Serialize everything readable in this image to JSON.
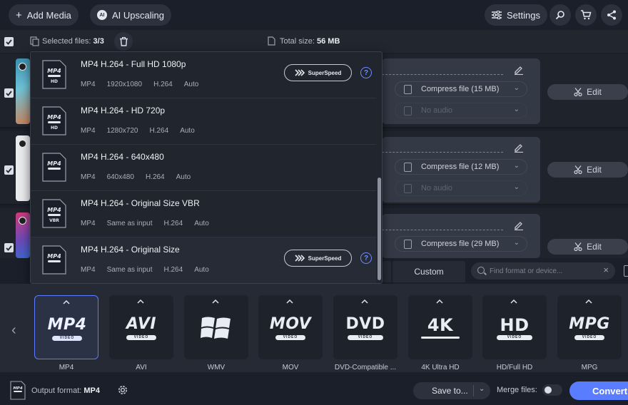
{
  "toolbar": {
    "add_media": "Add Media",
    "ai_upscaling": "AI Upscaling",
    "ai_badge": "AI",
    "settings": "Settings"
  },
  "selection": {
    "selected_label": "Selected files:",
    "selected_value": "3/3",
    "total_label": "Total size:",
    "total_value": "56 MB"
  },
  "files": [
    {
      "compress": "Compress file (15 MB)",
      "audio": "No audio",
      "edit": "Edit"
    },
    {
      "compress": "Compress file (12 MB)",
      "audio": "No audio",
      "edit": "Edit"
    },
    {
      "compress": "Compress file (29 MB)",
      "edit": "Edit"
    }
  ],
  "preset_menu": {
    "items": [
      {
        "name": "MP4 H.264 - Full HD 1080p",
        "icon_top": "MP4",
        "icon_bottom": "HD",
        "meta": [
          "MP4",
          "1920x1080",
          "H.264",
          "Auto"
        ],
        "superspeed": "SuperSpeed",
        "help": "?"
      },
      {
        "name": "MP4 H.264 - HD 720p",
        "icon_top": "MP4",
        "icon_bottom": "HD",
        "meta": [
          "MP4",
          "1280x720",
          "H.264",
          "Auto"
        ]
      },
      {
        "name": "MP4 H.264 - 640x480",
        "icon_top": "MP4",
        "icon_bottom": "",
        "meta": [
          "MP4",
          "640x480",
          "H.264",
          "Auto"
        ]
      },
      {
        "name": "MP4 H.264 - Original Size VBR",
        "icon_top": "MP4",
        "icon_bottom": "VBR",
        "meta": [
          "MP4",
          "Same as input",
          "H.264",
          "Auto"
        ]
      },
      {
        "name": "MP4 H.264 - Original Size",
        "icon_top": "MP4",
        "icon_bottom": "",
        "meta": [
          "MP4",
          "Same as input",
          "H.264",
          "Auto"
        ],
        "superspeed": "SuperSpeed",
        "help": "?"
      }
    ]
  },
  "format_tabs": {
    "custom": "Custom",
    "search_placeholder": "Find format or device..."
  },
  "formats": [
    {
      "logo": "MP4",
      "sub": "VIDEO",
      "label": "MP4",
      "selected": true
    },
    {
      "logo": "AVI",
      "sub": "VIDEO",
      "label": "AVI"
    },
    {
      "logo": "",
      "sub": "",
      "label": "WMV",
      "icon": "windows-logo-icon"
    },
    {
      "logo": "MOV",
      "sub": "VIDEO",
      "label": "MOV"
    },
    {
      "logo": "DVD",
      "sub": "VIDEO",
      "label": "DVD-Compatible ..."
    },
    {
      "logo": "4K",
      "sub": "",
      "label": "4K Ultra HD"
    },
    {
      "logo": "HD",
      "sub": "VIDEO",
      "label": "HD/Full HD"
    },
    {
      "logo": "MPG",
      "sub": "VIDEO",
      "label": "MPG"
    }
  ],
  "bottom": {
    "output_label": "Output format:",
    "output_value": "MP4",
    "save_to": "Save to...",
    "merge": "Merge files:",
    "convert": "Convert"
  },
  "colors": {
    "accent": "#5a7cff",
    "background": "#1b1f29",
    "panel": "#262a34"
  }
}
